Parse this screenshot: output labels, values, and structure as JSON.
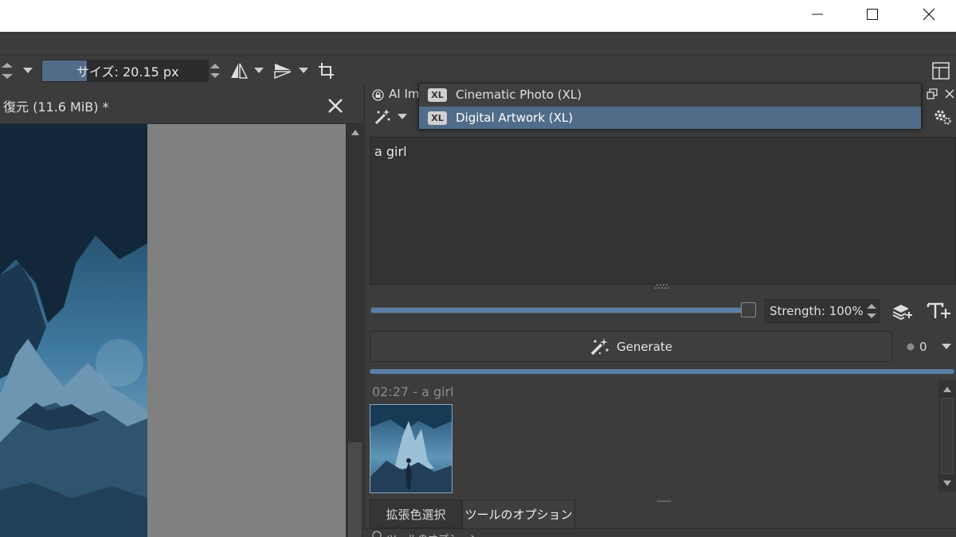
{
  "window": {
    "controls": [
      "minimize-icon",
      "maximize-icon",
      "close-icon"
    ]
  },
  "toolbar": {
    "size_label": "サイズ: 20.15 px",
    "size_fraction": 0.27
  },
  "document": {
    "title": "復元 (11.6 MiB) *"
  },
  "ai_docker": {
    "title_partial": "AI Im",
    "style_options": [
      {
        "badge": "XL",
        "label": "Cinematic Photo (XL)",
        "selected": false
      },
      {
        "badge": "XL",
        "label": "Digital Artwork (XL)",
        "selected": true
      }
    ],
    "prompt": "a girl",
    "strength_label": "Strength: 100%",
    "strength_value": 1.0,
    "generate_label": "Generate",
    "queue_count": "0",
    "progress_fraction": 1.0,
    "history": [
      {
        "label": "02:27 - a girl"
      }
    ]
  },
  "bottom_tabs": [
    {
      "label": "拡張色選択",
      "active": false
    },
    {
      "label": "ツールのオプション",
      "active": true
    }
  ],
  "bottom_strip": {
    "label": "ツールのオプション"
  },
  "colors": {
    "accent": "#5a7fa5",
    "selection": "#506c88",
    "panel": "#3c3c3c"
  }
}
